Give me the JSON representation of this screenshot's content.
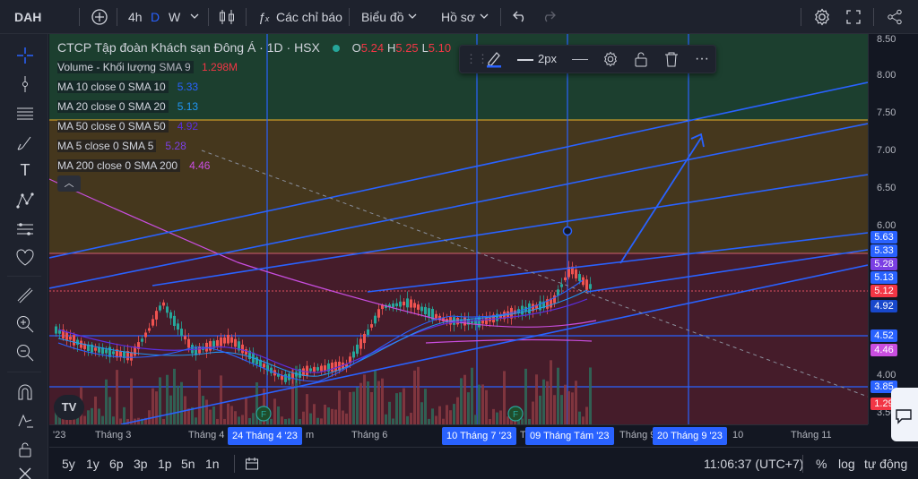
{
  "header": {
    "symbol": "DAH",
    "interval_4h": "4h",
    "interval_D": "D",
    "interval_W": "W",
    "indicators_label": "Các chỉ báo",
    "chart_label": "Biểu đồ",
    "profile_label": "Hồ sơ"
  },
  "legend": {
    "title": "CTCP Tập đoàn Khách sạn Đông Á · 1D · HSX",
    "ohlc": {
      "o_label": "O",
      "o": "5.24",
      "h_label": "H",
      "h": "5.25",
      "l_label": "L",
      "l": "5.10"
    },
    "rows": [
      {
        "name": "Volume - Khối lượng",
        "param": "SMA 9",
        "value": "1.298M",
        "color": "#f23645"
      },
      {
        "name": "MA 10 close 0 SMA 10",
        "param": "",
        "value": "5.33",
        "color": "#2962ff"
      },
      {
        "name": "MA 20 close 0 SMA 20",
        "param": "",
        "value": "5.13",
        "color": "#2196f3"
      },
      {
        "name": "MA 50 close 0 SMA 50",
        "param": "",
        "value": "4.92",
        "color": "#5b2fe0"
      },
      {
        "name": "MA 5 close 0 SMA 5",
        "param": "",
        "value": "5.28",
        "color": "#7b3fe4"
      },
      {
        "name": "MA 200 close 0 SMA 200",
        "param": "",
        "value": "4.46",
        "color": "#c94ee0"
      }
    ]
  },
  "drawing_toolbar": {
    "width_label": "2px"
  },
  "y_axis": {
    "ticks": [
      "8.50",
      "8.00",
      "7.50",
      "7.00",
      "6.50",
      "6.00",
      "4.00",
      "3.50"
    ],
    "badges": [
      {
        "value": "5.63",
        "color": "#2962ff"
      },
      {
        "value": "5.33",
        "color": "#2962ff"
      },
      {
        "value": "5.28",
        "color": "#7b3fe4"
      },
      {
        "value": "5.13",
        "color": "#2962ff"
      },
      {
        "value": "5.12",
        "color": "#f23645"
      },
      {
        "value": "4.92",
        "color": "#1848cc"
      },
      {
        "value": "4.52",
        "color": "#2962ff"
      },
      {
        "value": "4.46",
        "color": "#c94ee0"
      },
      {
        "value": "3.85",
        "color": "#2962ff"
      },
      {
        "value": "1.29",
        "color": "#f23645"
      }
    ]
  },
  "x_axis": {
    "labels": [
      "'23",
      "Tháng 3",
      "Tháng 4",
      "m",
      "Tháng 6",
      "T",
      "Tháng 9",
      "10",
      "Tháng 11"
    ],
    "badges": [
      "24 Tháng 4 '23",
      "10 Tháng 7 '23",
      "09 Tháng Tám '23",
      "20 Tháng 9 '23"
    ]
  },
  "bottom": {
    "ranges": [
      "5y",
      "1y",
      "6p",
      "3p",
      "1p",
      "5n",
      "1n"
    ],
    "clock": "11:06:37 (UTC+7)",
    "percent": "%",
    "log": "log",
    "auto": "tự động"
  },
  "chart_logo": "TV"
}
